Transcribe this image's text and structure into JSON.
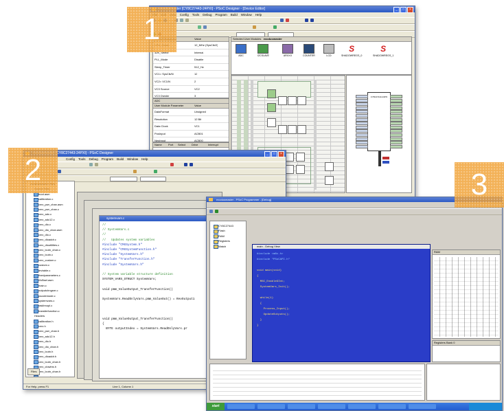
{
  "screens": [
    {
      "badge": "1",
      "title": "exodusmaster [CY8C27443-24PXI] - PSoC Designer - [Device Editor]",
      "menu": [
        "File",
        "Edit",
        "View",
        "Config",
        "Tools",
        "Debug",
        "Program",
        "Build",
        "Window",
        "Help"
      ],
      "global_params": {
        "headers": [
          "Global Resources",
          "Value"
        ],
        "rows": [
          [
            "CPU_Clock",
            "12_MHz (SysClk/2)"
          ],
          [
            "32K_Select",
            "Internal"
          ],
          [
            "PLL_Mode",
            "Disable"
          ],
          [
            "Sleep_Timer",
            "512_Hz"
          ],
          [
            "VC1= SysClk/N",
            "12"
          ],
          [
            "VC2= VC1/N",
            "2"
          ],
          [
            "VC3 Source",
            "VC2"
          ],
          [
            "VC3 Divider",
            "3"
          ]
        ]
      },
      "user_params": {
        "section": "ADC",
        "headers": [
          "User Module Parameter",
          "Value"
        ],
        "rows": [
          [
            "DataFormat",
            "Unsigned"
          ],
          [
            "Resolution",
            "12 Bit"
          ],
          [
            "Data Clock",
            "VC1"
          ],
          [
            "PosInput",
            "ACB01"
          ],
          [
            "NegInput",
            "ACB00"
          ]
        ]
      },
      "pin_table": {
        "headers": [
          "Name",
          "Port",
          "Select",
          "Drive",
          "Interrupt"
        ],
        "rows": [
          [
            "Port_0_0",
            "P0[0]",
            "StdCPU",
            "High Z An",
            "DisableInt"
          ],
          [
            "Port_0_1",
            "P0[1]",
            "AnalogIn",
            "High Z An",
            "DisableInt"
          ],
          [
            "Port_0_2",
            "P0[2]",
            "StdCPU",
            "High Z An",
            "DisableInt"
          ]
        ]
      },
      "modules_caption": "Selected User Modules",
      "project_name": "exodusmaster",
      "modules": [
        "ADC",
        "I2CSLAVE",
        "ARXXX",
        "COUNTER",
        "LCD",
        "SHADOWREGS_0",
        "SHADOWREGS_1"
      ],
      "chip_label": "CY8C27443-24PXI"
    },
    {
      "badge": "2",
      "title": "exodusmaster [CY8C27443-24PXI] - PSoC Designer",
      "menu": [
        "File",
        "Edit",
        "View",
        "Config",
        "Tools",
        "Debug",
        "Program",
        "Build",
        "Window",
        "Help"
      ],
      "tree_root": "exodusmaster files",
      "source_folder": "Source Files",
      "source_files": [
        "boot.asm",
        "calibration.c",
        "cmx_pwr_chan.asm",
        "cmx_pwr_chan.c",
        "cmx_adc.c",
        "cmx_adc12.c",
        "cmx_dio.c",
        "cmx_dio_chan.asm",
        "cmx_dio.c",
        "cmx_dioaddr.c",
        "cmx_dioutilities.c",
        "cmx_lcutn_chan.c",
        "cmx_lcutn.c",
        "cmx_custom.c",
        "custom.c",
        "drvtable.c",
        "fixedparameters.c",
        "i2cBsel.asm",
        "main.c",
        "outputchngsre.c",
        "psoclemode.c",
        "systemvars.c",
        "taskhnupl.c",
        "transferfunction.c"
      ],
      "header_folder": "Headers",
      "header_files": [
        "calibration.h",
        "cmx.h",
        "cmx_pwr_chan.h",
        "cmx_adc12.h",
        "cmx_dio.h",
        "cmx_dio_chan.h",
        "cmx_lcutn.h",
        "cmx_dioaddr.h",
        "cmx_lcutn_chan.h",
        "cmx_clowlns.h",
        "cmx_lcutn_chan.h",
        "cmx_pwr.h"
      ],
      "files_tab": "Files",
      "code_tab": "systemvars.c",
      "code_lines": [
        "//",
        "// SystemVars.c",
        "//",
        "//   Updates system variables",
        "#include \"CMXSystem.h\"",
        "#include \"CMXSystemFunction.h\"",
        "#include \"SystemVars.h\"",
        "#include \"TransferFunction.h\"",
        "#include \"SystemVars.h\"",
        "",
        "// System variable structure definition",
        "SYSTEM_VARS_STRUCT SystemVars;",
        "",
        "void pmm_ValueOutput_TransferFunction()",
        "",
        "SystemVars.ReadOnlyVars.pmm_ValueOut() = RevOutput1",
        "",
        "",
        "",
        "void pmm_ValueOutput_TransferFunction()",
        "{",
        "  BYTE outputIndex = SystemVars.ReadOnlyVars.pr"
      ],
      "status_left": "For Help, press F1",
      "status_right": "Line 1, Column 1"
    },
    {
      "badge": "3",
      "title": "exodusmaster - PSoC Programmer - [Debug]",
      "tree_items": [
        "CY8C27443",
        "Flash",
        "RAM",
        "Registers",
        "Watch"
      ],
      "code_tab": "main - Debug View",
      "code_lines": [
        "#include <m8c.h>",
        "#include \"PSoCAPI.h\"",
        "",
        "void main(void)",
        "{",
        "  M8C_EnableGInt;",
        "  SystemVars_Init();",
        "",
        "  while(1)",
        "  {",
        "    Process_Input();",
        "    UpdateOutputs();",
        "  }",
        "}"
      ],
      "ram_tab": "RAM",
      "registers_tab": "Registers Bank 0",
      "start_label": "start"
    }
  ],
  "colors": {
    "badge": "#f0a032",
    "titlebar": "#2b59c4",
    "editor_bg": "#2a3dc8",
    "taskbar": "#245dd0"
  }
}
